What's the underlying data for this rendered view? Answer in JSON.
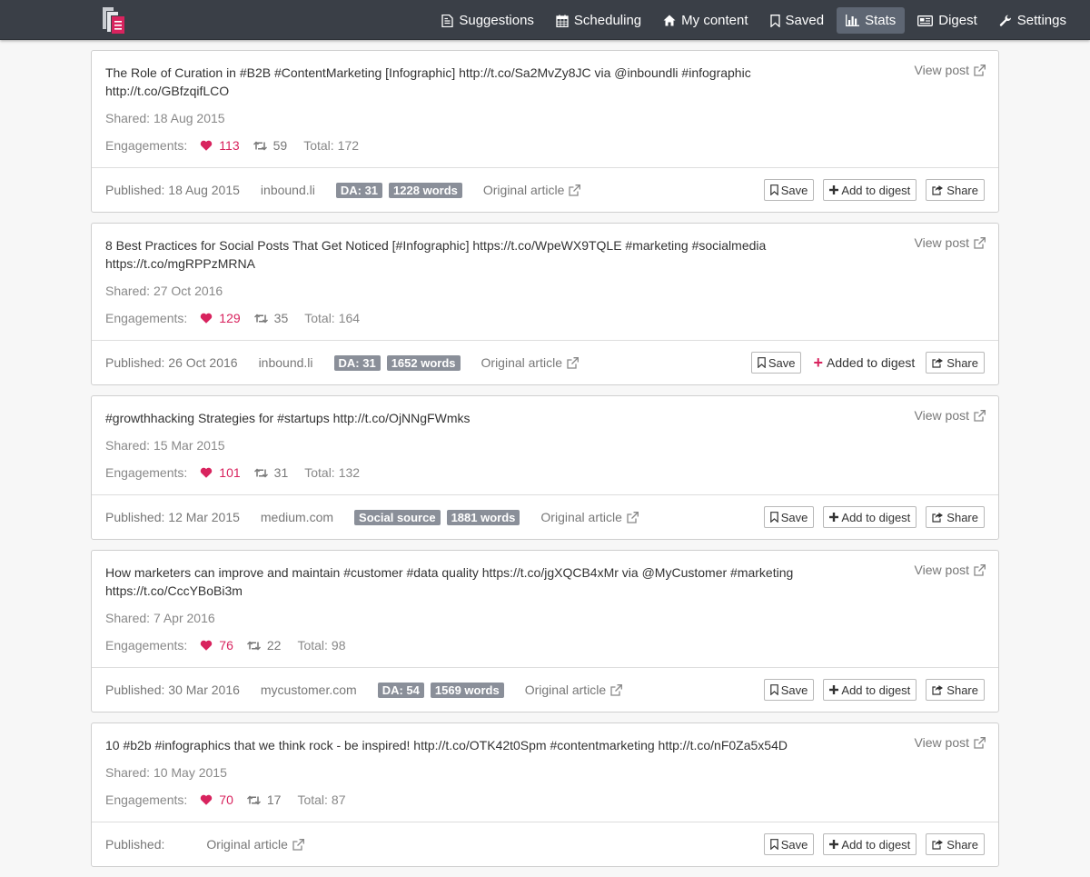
{
  "nav": {
    "items": [
      {
        "label": "Suggestions",
        "icon": "file-text-icon",
        "active": false
      },
      {
        "label": "Scheduling",
        "icon": "calendar-icon",
        "active": false
      },
      {
        "label": "My content",
        "icon": "home-icon",
        "active": false
      },
      {
        "label": "Saved",
        "icon": "bookmark-icon",
        "active": false
      },
      {
        "label": "Stats",
        "icon": "bar-chart-icon",
        "active": true
      },
      {
        "label": "Digest",
        "icon": "newspaper-icon",
        "active": false
      },
      {
        "label": "Settings",
        "icon": "wrench-icon",
        "active": false
      }
    ]
  },
  "colors": {
    "navbar": "#3a3f47",
    "nav_active": "#5e6673",
    "accent": "#d8235e",
    "badge": "#8a8f99"
  },
  "labels": {
    "view_post": "View post",
    "shared_prefix": "Shared:",
    "engagements": "Engagements:",
    "total_prefix": "Total:",
    "published_prefix": "Published:",
    "original_article": "Original article",
    "save": "Save",
    "add_to_digest": "Add to digest",
    "added_to_digest": "Added to digest",
    "share": "Share"
  },
  "posts": [
    {
      "text": "The Role of Curation in #B2B #ContentMarketing [Infographic] http://t.co/Sa2MvZy8JC via @inboundli #infographic http://t.co/GBfzqifLCO",
      "shared": "18 Aug 2015",
      "likes": "113",
      "retweets": "59",
      "total": "172",
      "published": "18 Aug 2015",
      "domain": "inbound.li",
      "badges": [
        "DA: 31",
        "1228 words"
      ],
      "added": false
    },
    {
      "text": "8 Best Practices for Social Posts That Get Noticed [#Infographic] https://t.co/WpeWX9TQLE #marketing #socialmedia https://t.co/mgRPPzMRNA",
      "shared": "27 Oct 2016",
      "likes": "129",
      "retweets": "35",
      "total": "164",
      "published": "26 Oct 2016",
      "domain": "inbound.li",
      "badges": [
        "DA: 31",
        "1652 words"
      ],
      "added": true
    },
    {
      "text": "#growthhacking Strategies for #startups http://t.co/OjNNgFWmks",
      "shared": "15 Mar 2015",
      "likes": "101",
      "retweets": "31",
      "total": "132",
      "published": "12 Mar 2015",
      "domain": "medium.com",
      "badges": [
        "Social source",
        "1881 words"
      ],
      "added": false
    },
    {
      "text": "How marketers can improve and maintain #customer #data quality https://t.co/jgXQCB4xMr via @MyCustomer #marketing https://t.co/CccYBoBi3m",
      "shared": "7 Apr 2016",
      "likes": "76",
      "retweets": "22",
      "total": "98",
      "published": "30 Mar 2016",
      "domain": "mycustomer.com",
      "badges": [
        "DA: 54",
        "1569 words"
      ],
      "added": false
    },
    {
      "text": "10 #b2b #infographics that we think rock - be inspired! http://t.co/OTK42t0Spm #contentmarketing http://t.co/nF0Za5x54D",
      "shared": "10 May 2015",
      "likes": "70",
      "retweets": "17",
      "total": "87",
      "published": "",
      "domain": "",
      "badges": [],
      "added": false
    }
  ]
}
